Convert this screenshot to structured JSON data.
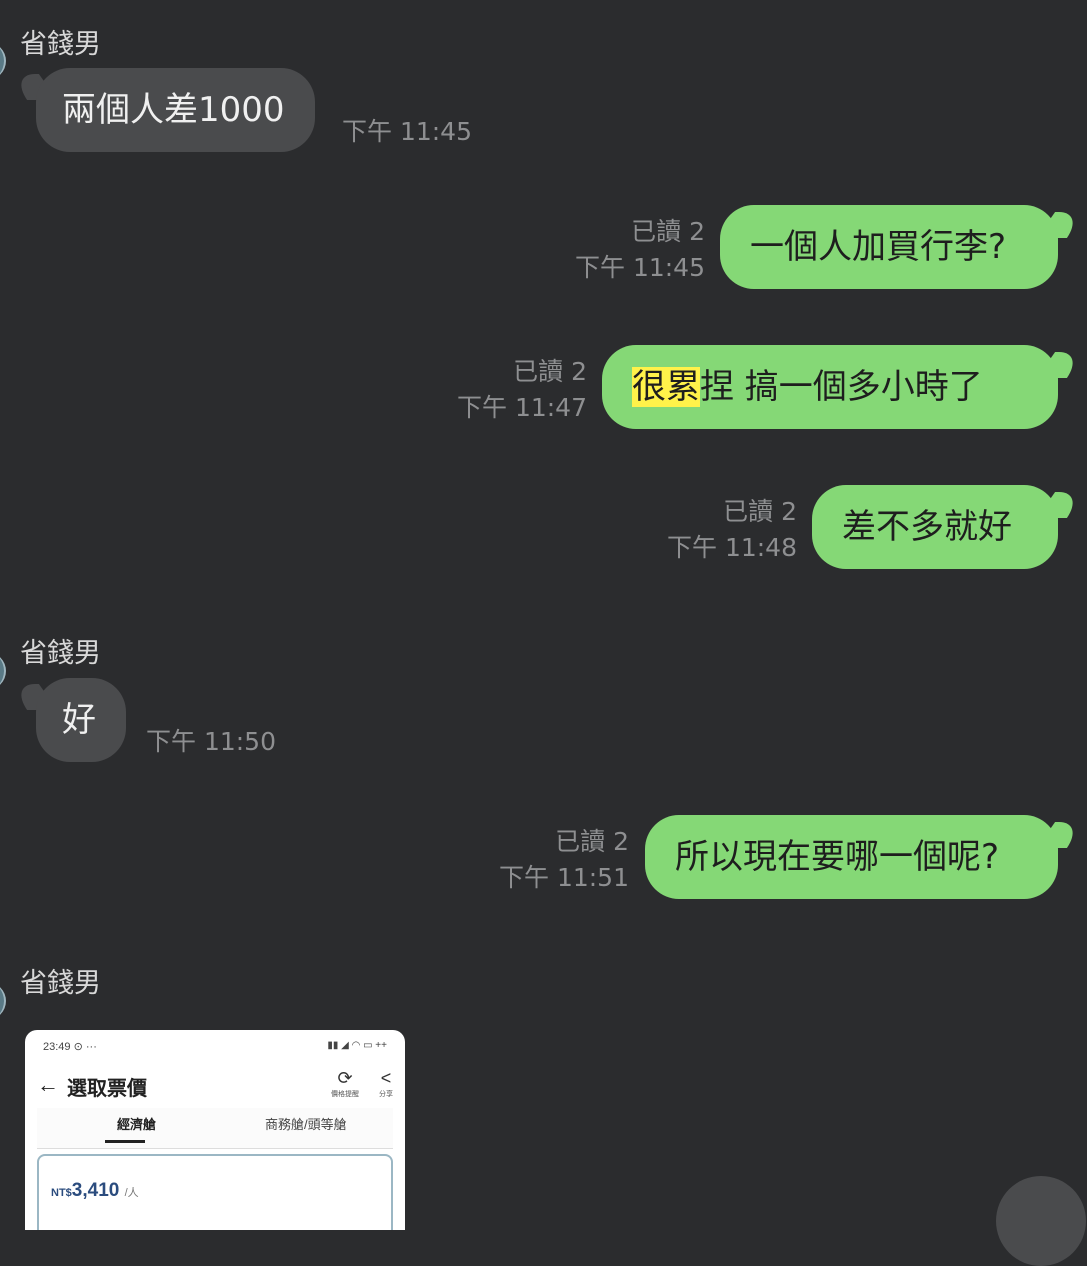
{
  "chat": {
    "messages": [
      {
        "sender": "省錢男",
        "text": "兩個人差1000",
        "time": "下午 11:45"
      },
      {
        "read": "已讀 2",
        "time": "下午 11:45",
        "text": "一個人加買行李?"
      },
      {
        "read": "已讀 2",
        "time": "下午 11:47",
        "text_highlight": "很累",
        "text_rest": "捏  搞一個多小時了"
      },
      {
        "read": "已讀 2",
        "time": "下午 11:48",
        "text": "差不多就好"
      },
      {
        "sender": "省錢男",
        "text": "好",
        "time": "下午 11:50"
      },
      {
        "read": "已讀 2",
        "time": "下午 11:51",
        "text": "所以現在要哪一個呢?"
      },
      {
        "sender": "省錢男"
      }
    ]
  },
  "shared_screenshot": {
    "status_time": "23:49",
    "status_dots": "⊙ ···",
    "status_icons": "▮▮ ◢ ◠ ▭ ++",
    "back_icon": "←",
    "title": "選取票價",
    "refresh_icon": "⟳",
    "refresh_label": "價格提醒",
    "share_icon": "<",
    "share_label": "分享",
    "tab_economy": "經濟艙",
    "tab_business": "商務艙/頭等艙",
    "price_currency": "NT$",
    "price_value": "3,410",
    "price_unit": "/人"
  },
  "colors": {
    "background": "#2b2c2e",
    "incoming_bubble": "#4a4b4d",
    "outgoing_bubble": "#85d876",
    "highlight": "#fff24a"
  }
}
